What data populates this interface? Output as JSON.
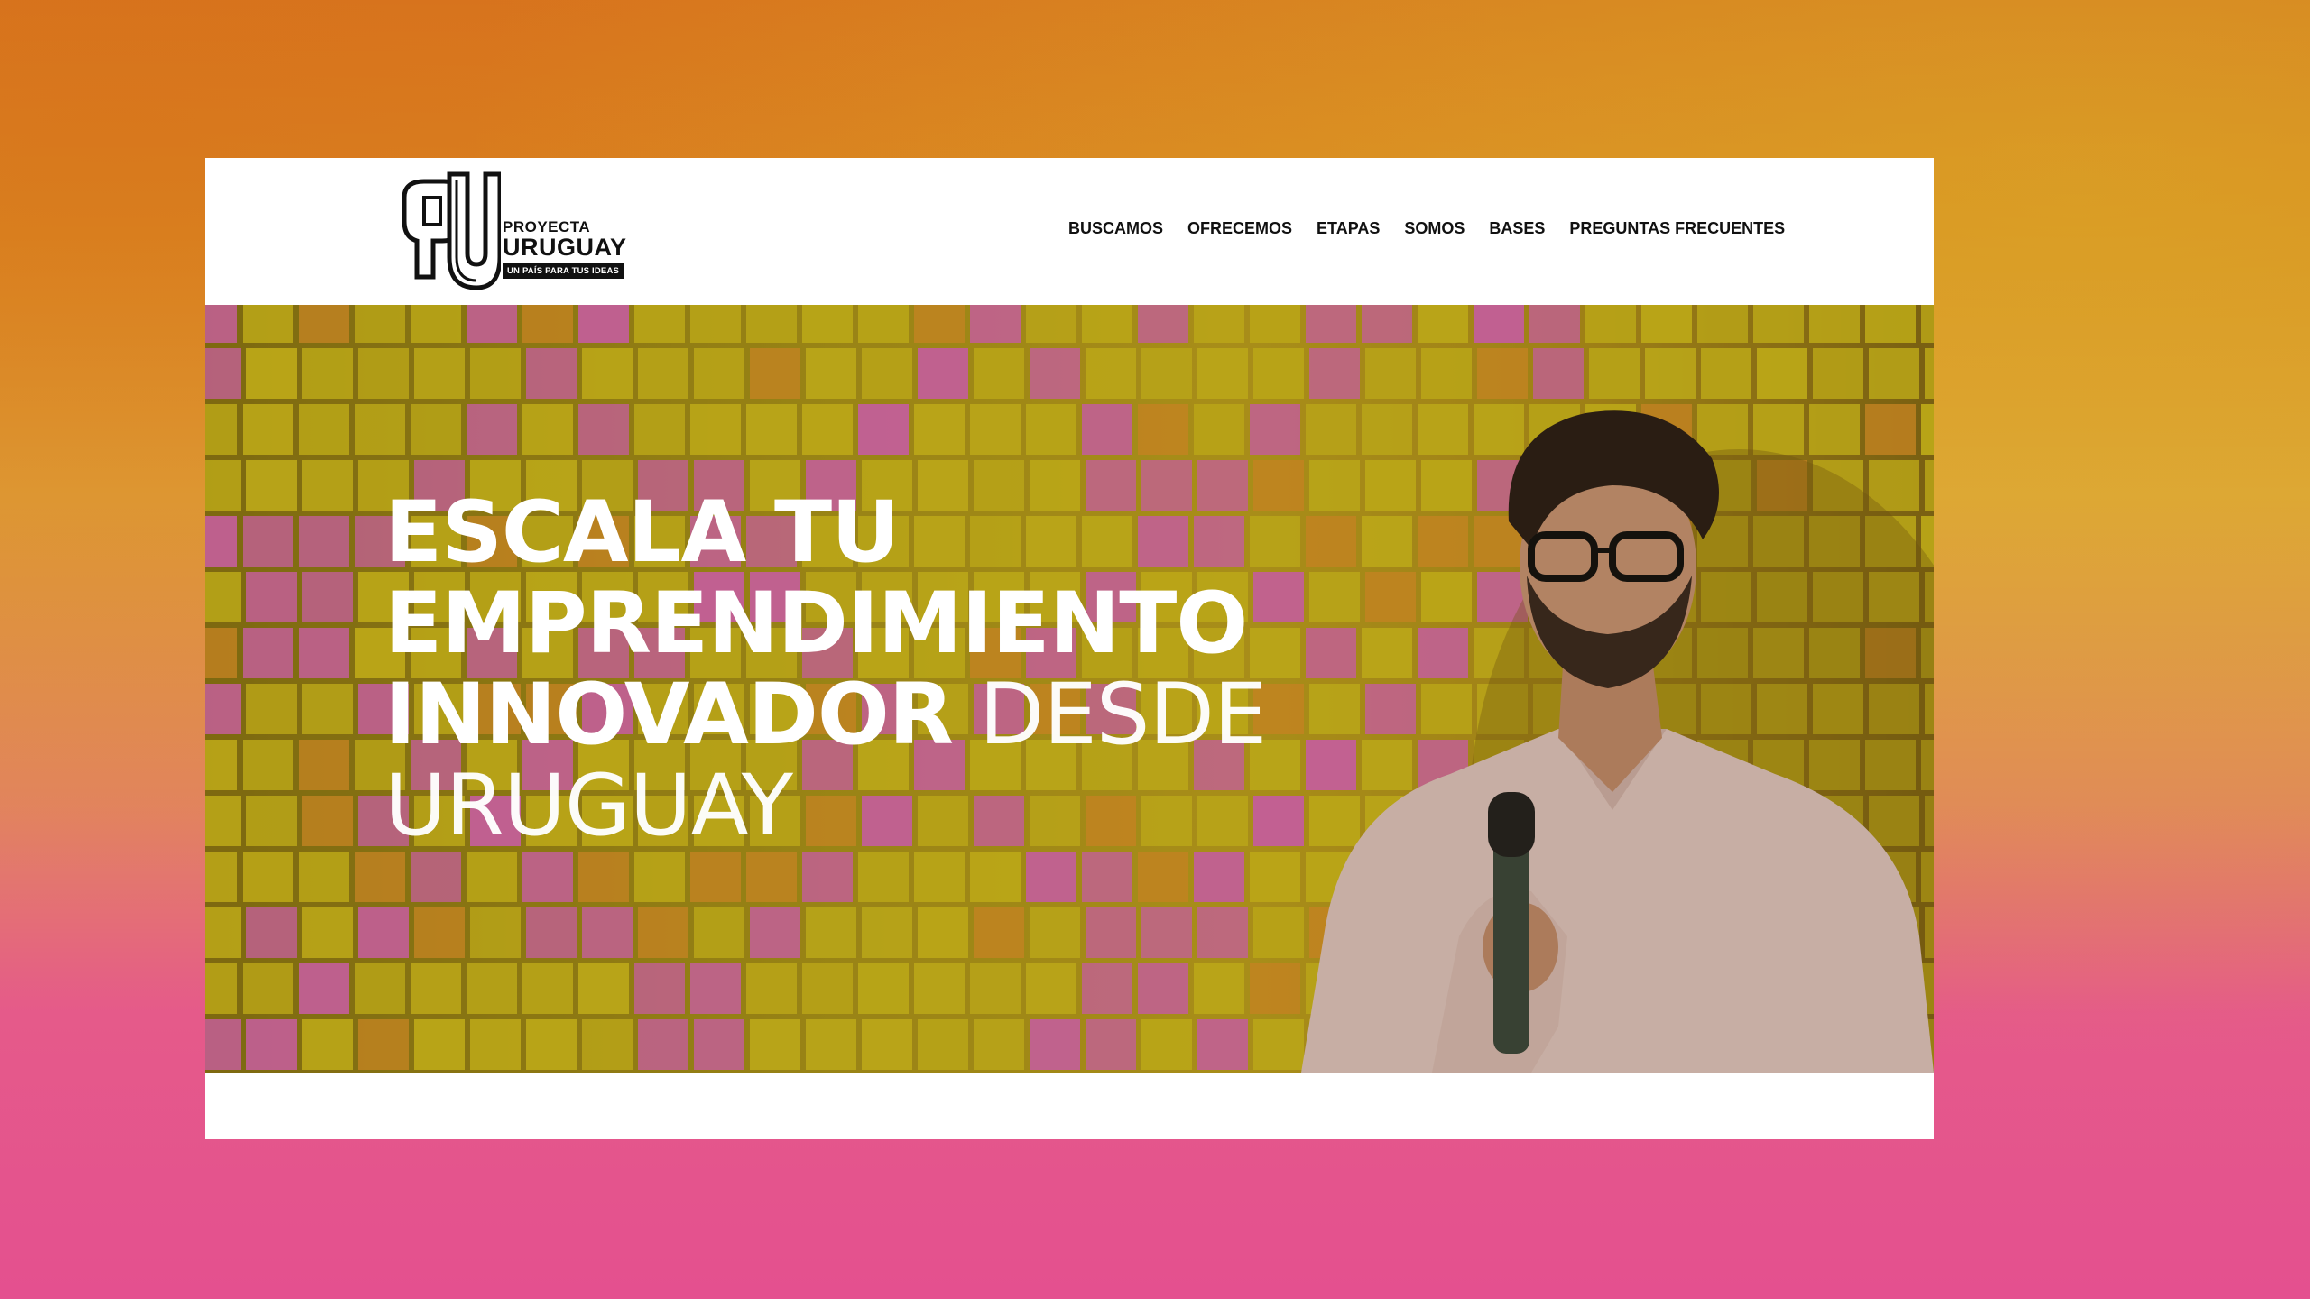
{
  "brand": {
    "name_top": "PROYECTA",
    "name_main": "URUGUAY",
    "tagline": "UN PAÍS PARA TUS IDEAS"
  },
  "nav": {
    "items": [
      {
        "label": "BUSCAMOS"
      },
      {
        "label": "OFRECEMOS"
      },
      {
        "label": "ETAPAS"
      },
      {
        "label": "SOMOS"
      },
      {
        "label": "BASES"
      },
      {
        "label": "PREGUNTAS FRECUENTES"
      }
    ]
  },
  "hero": {
    "line1": "ESCALA TU",
    "line2": "EMPRENDIMIENTO",
    "line3_bold": "INNOVADOR",
    "line3_light": "DESDE",
    "line4_light": "URUGUAY"
  },
  "colors": {
    "accent_orange": "#d9761f",
    "accent_pink": "#e4508f",
    "sticky_yellow": "#d9c41e",
    "sticky_pink": "#e36fb6",
    "sticky_orange": "#e59a2a"
  }
}
